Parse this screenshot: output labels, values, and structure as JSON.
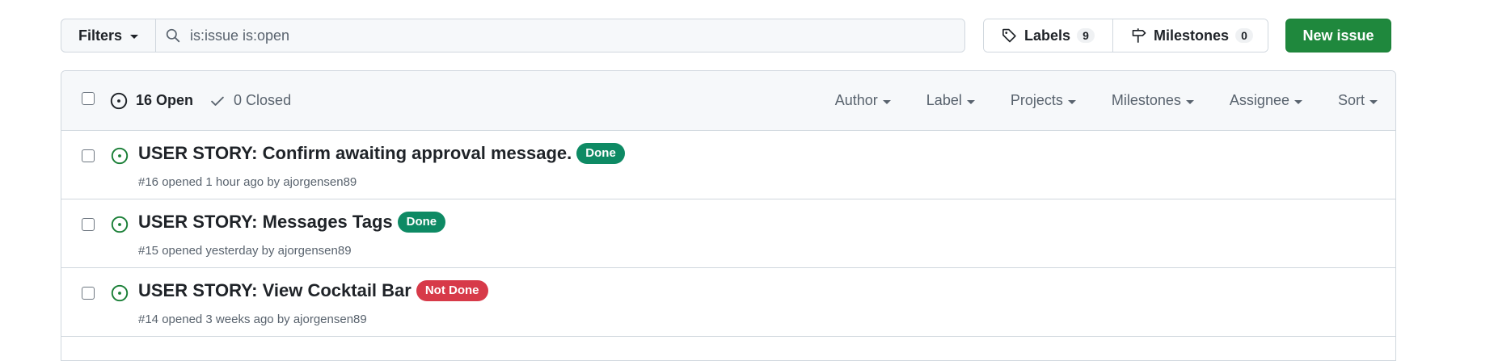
{
  "toolbar": {
    "filters_label": "Filters",
    "search_value": "is:issue is:open",
    "labels_label": "Labels",
    "labels_count": "9",
    "milestones_label": "Milestones",
    "milestones_count": "0",
    "new_issue_label": "New issue"
  },
  "header": {
    "open_label": "16 Open",
    "closed_label": "0 Closed",
    "filters": [
      "Author",
      "Label",
      "Projects",
      "Milestones",
      "Assignee",
      "Sort"
    ]
  },
  "colors": {
    "open_icon": "#1a7f37",
    "done_label": "#0e8a64",
    "not_done_label": "#d73a49",
    "primary": "#1f883d"
  },
  "issues": [
    {
      "title": "USER STORY: Confirm awaiting approval message.",
      "label": "Done",
      "label_color": "#0e8a64",
      "number": "#16",
      "opened": "opened 1 hour ago by",
      "author": "ajorgensen89"
    },
    {
      "title": "USER STORY: Messages Tags",
      "label": "Done",
      "label_color": "#0e8a64",
      "number": "#15",
      "opened": "opened yesterday by",
      "author": "ajorgensen89"
    },
    {
      "title": "USER STORY: View Cocktail Bar",
      "label": "Not Done",
      "label_color": "#d73a49",
      "number": "#14",
      "opened": "opened 3 weeks ago by",
      "author": "ajorgensen89"
    }
  ]
}
